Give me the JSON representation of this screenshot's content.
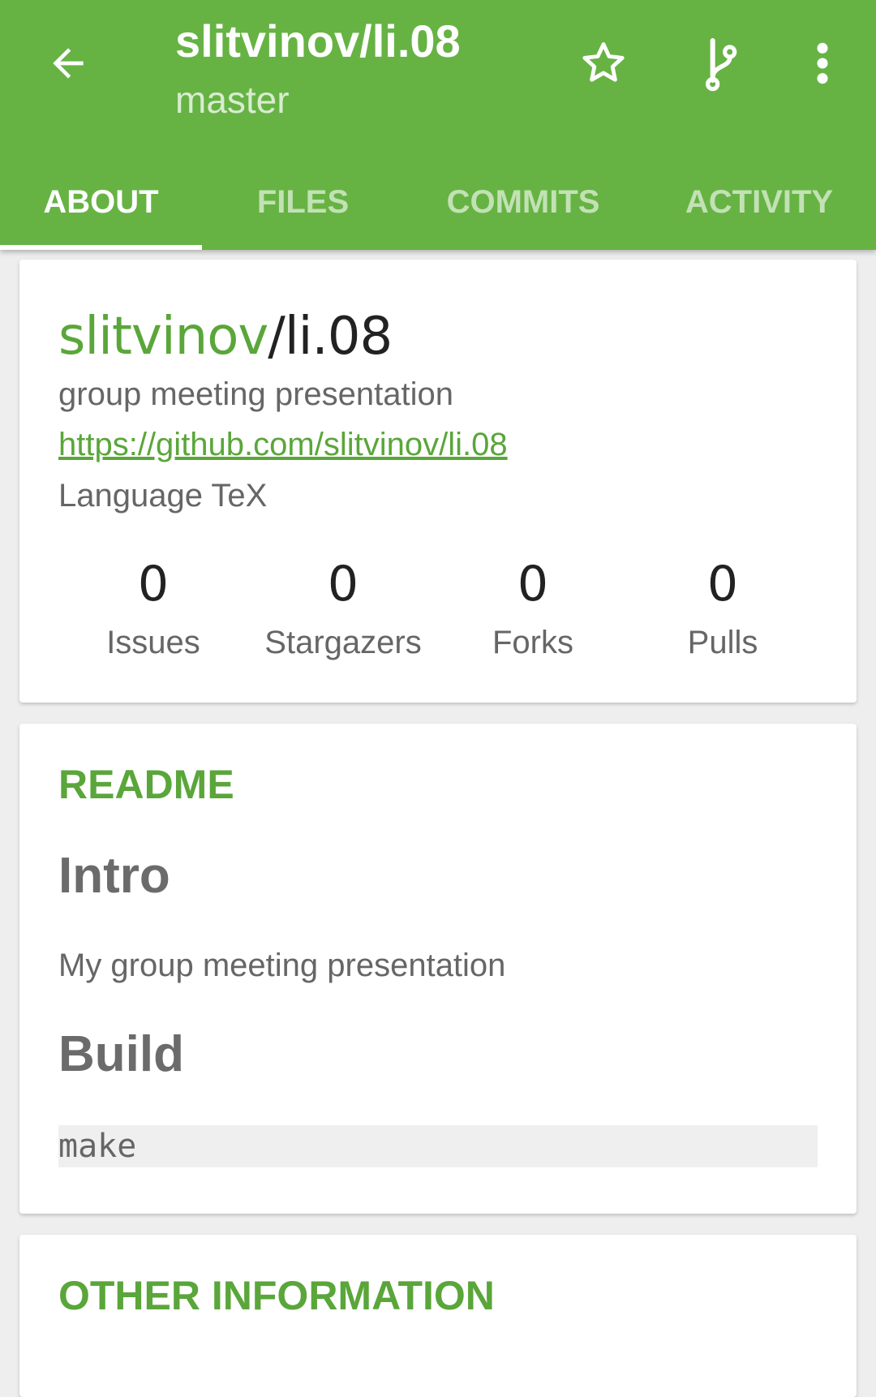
{
  "colors": {
    "primary": "#66b344",
    "accent": "#5aa63a",
    "text": "#222222",
    "secondary_text": "#666666"
  },
  "toolbar": {
    "back_icon": "arrow-left-icon",
    "title": "slitvinov/li.08",
    "subtitle": "master",
    "star_icon": "star-outline-icon",
    "branch_icon": "source-branch-icon",
    "more_icon": "more-vert-icon"
  },
  "tabs": [
    {
      "label": "ABOUT",
      "active": true
    },
    {
      "label": "FILES",
      "active": false
    },
    {
      "label": "COMMITS",
      "active": false
    },
    {
      "label": "ACTIVITY",
      "active": false
    }
  ],
  "repo": {
    "owner": "slitvinov",
    "separator": "/",
    "name": "li.08",
    "description": "group meeting presentation",
    "url": "https://github.com/slitvinov/li.08",
    "language": "Language TeX",
    "stats": [
      {
        "value": "0",
        "label": "Issues"
      },
      {
        "value": "0",
        "label": "Stargazers"
      },
      {
        "value": "0",
        "label": "Forks"
      },
      {
        "value": "0",
        "label": "Pulls"
      }
    ]
  },
  "readme": {
    "title": "README",
    "heading_intro": "Intro",
    "intro_text": "My group meeting presentation",
    "heading_build": "Build",
    "code": "make"
  },
  "other": {
    "title": "OTHER INFORMATION"
  }
}
